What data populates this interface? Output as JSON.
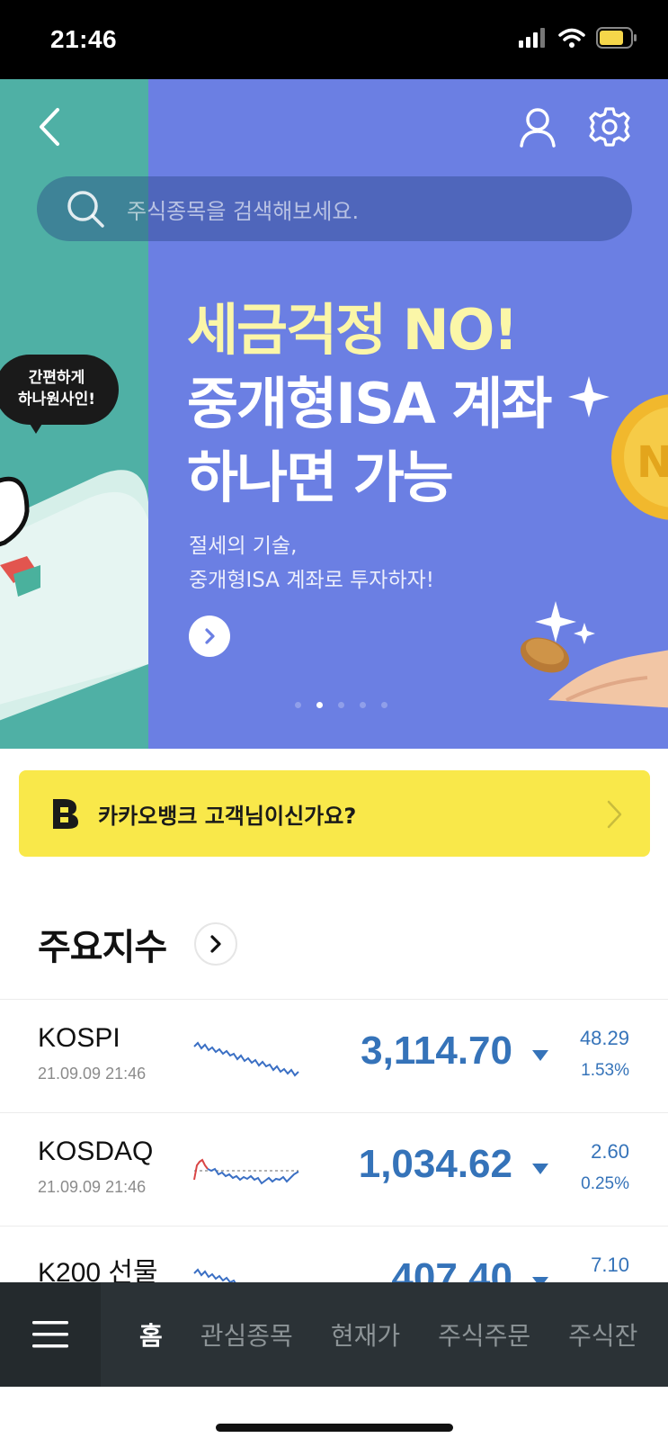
{
  "status_bar": {
    "time": "21:46",
    "battery_color": "#f5d64a"
  },
  "hero": {
    "bubble_line1": "간편하게",
    "bubble_line2": "하나원사인!",
    "title_line1": "세금걱정 NO!",
    "title_line2": "중개형ISA 계좌",
    "title_line3": "하나면 가능",
    "subtitle_line1": "절세의 기술,",
    "subtitle_line2": "중개형ISA 계좌로 투자하자!",
    "page_count": 5,
    "active_page": 2,
    "left_panel_color": "#4fb0a5",
    "main_color": "#6b7fe3"
  },
  "search": {
    "placeholder": "주식종목을 검색해보세요."
  },
  "kakao_banner": {
    "label": "카카오뱅크 고객님이신가요?",
    "color": "#f9e84a"
  },
  "indices_section": {
    "title": "주요지수"
  },
  "indices": [
    {
      "name": "KOSPI",
      "date": "21.09.09 21:46",
      "value": "3,114.70",
      "change": "48.29",
      "pct": "1.53%",
      "direction": "down"
    },
    {
      "name": "KOSDAQ",
      "date": "21.09.09 21:46",
      "value": "1,034.62",
      "change": "2.60",
      "pct": "0.25%",
      "direction": "down"
    },
    {
      "name": "K200 선물",
      "date": "",
      "value": "407.40",
      "change": "7.10",
      "pct": "",
      "direction": "down"
    }
  ],
  "bottom_nav": {
    "tabs": [
      "홈",
      "관심종목",
      "현재가",
      "주식주문",
      "주식잔"
    ],
    "active_tab": "홈"
  }
}
